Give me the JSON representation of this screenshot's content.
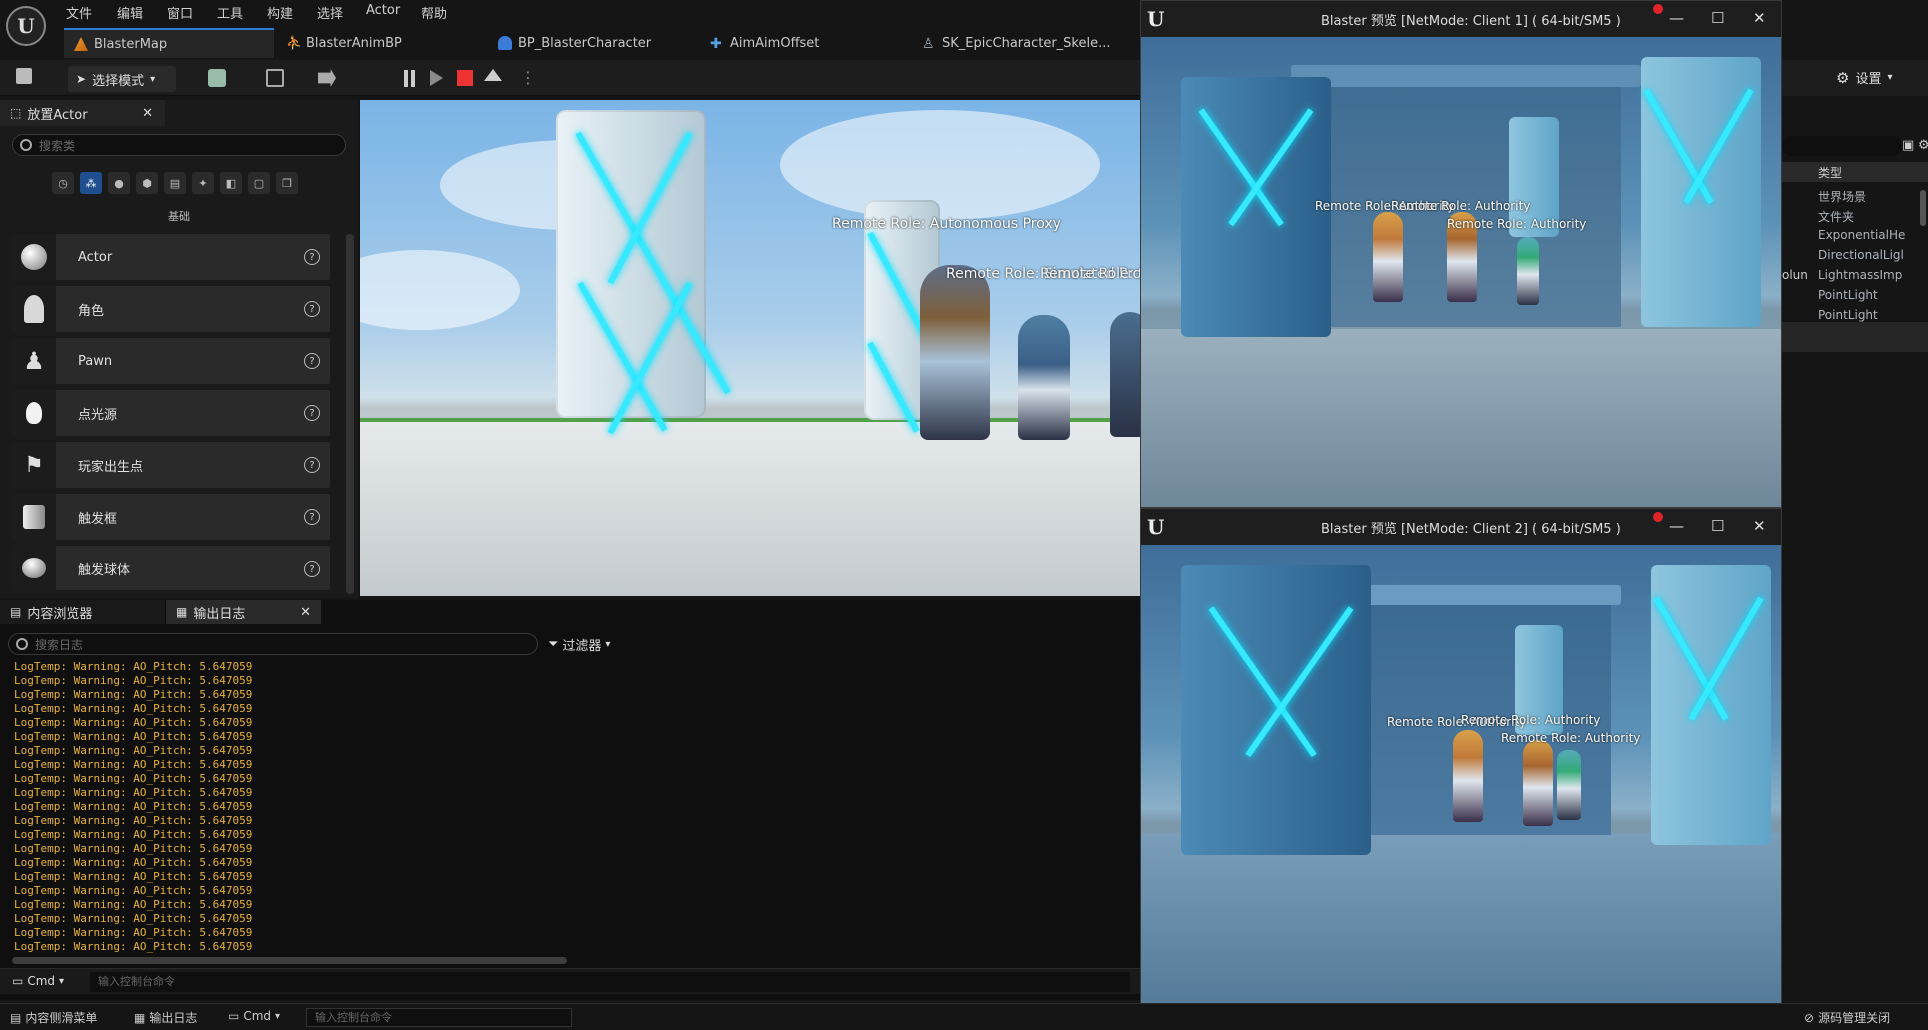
{
  "menu": {
    "items": [
      "文件",
      "编辑",
      "窗口",
      "工具",
      "构建",
      "选择",
      "Actor",
      "帮助"
    ]
  },
  "tabs": [
    {
      "label": "BlasterMap",
      "icon": "map-icon",
      "active": true
    },
    {
      "label": "BlasterAnimBP",
      "icon": "anim-blueprint-icon",
      "active": false
    },
    {
      "label": "BP_BlasterCharacter",
      "icon": "character-icon",
      "active": false
    },
    {
      "label": "AimAimOffset",
      "icon": "aim-offset-icon",
      "active": false
    },
    {
      "label": "SK_EpicCharacter_Skele...",
      "icon": "skeleton-icon",
      "active": false
    }
  ],
  "toolbar": {
    "mode_label": "选择模式",
    "settings_label": "设置"
  },
  "place_actor": {
    "title": "放置Actor",
    "search_placeholder": "搜索类",
    "category": "基础",
    "items": [
      {
        "label": "Actor",
        "icon": "sphere-icon"
      },
      {
        "label": "角色",
        "icon": "character-icon"
      },
      {
        "label": "Pawn",
        "icon": "pawn-icon"
      },
      {
        "label": "点光源",
        "icon": "point-light-icon"
      },
      {
        "label": "玩家出生点",
        "icon": "player-start-icon"
      },
      {
        "label": "触发框",
        "icon": "trigger-box-icon"
      },
      {
        "label": "触发球体",
        "icon": "trigger-sphere-icon"
      }
    ]
  },
  "viewport": {
    "labels": [
      "Remote Role: Autonomous Proxy",
      "Remote Role: Simulated Proxy",
      "Remote Role: Simulated Pro"
    ]
  },
  "log_panel": {
    "tabs": [
      {
        "label": "内容浏览器"
      },
      {
        "label": "输出日志"
      }
    ],
    "search_placeholder": "搜索日志",
    "filter_label": "过滤器",
    "lines": [
      "LogTemp: Warning: AO_Pitch: 5.647059",
      "LogTemp: Warning: AO_Pitch: 5.647059",
      "LogTemp: Warning: AO_Pitch: 5.647059",
      "LogTemp: Warning: AO_Pitch: 5.647059",
      "LogTemp: Warning: AO_Pitch: 5.647059",
      "LogTemp: Warning: AO_Pitch: 5.647059",
      "LogTemp: Warning: AO_Pitch: 5.647059",
      "LogTemp: Warning: AO_Pitch: 5.647059",
      "LogTemp: Warning: AO_Pitch: 5.647059",
      "LogTemp: Warning: AO_Pitch: 5.647059",
      "LogTemp: Warning: AO_Pitch: 5.647059",
      "LogTemp: Warning: AO_Pitch: 5.647059",
      "LogTemp: Warning: AO_Pitch: 5.647059",
      "LogTemp: Warning: AO_Pitch: 5.647059",
      "LogTemp: Warning: AO_Pitch: 5.647059",
      "LogTemp: Warning: AO_Pitch: 5.647059",
      "LogTemp: Warning: AO_Pitch: 5.647059",
      "LogTemp: Warning: AO_Pitch: 5.647059",
      "LogTemp: Warning: AO_Pitch: 5.647059",
      "LogTemp: Warning: AO_Pitch: 5.647059",
      "LogTemp: Warning: AO_Pitch: 5.647059"
    ],
    "cmd_label": "Cmd",
    "cmd_placeholder": "输入控制台命令"
  },
  "statusbar": {
    "drawer_label": "内容侧滑菜单",
    "log_label": "输出日志",
    "cmd_label": "Cmd",
    "cmd_placeholder": "输入控制台命令",
    "source_control": "源码管理关闭"
  },
  "outliner": {
    "header": "类型",
    "rows": [
      "世界场景",
      "文件夹",
      "ExponentialHe",
      "DirectionalLigl",
      "LightmassImp",
      "PointLight",
      "PointLight"
    ],
    "side_text": "olun"
  },
  "client1": {
    "title": "Blaster 预览 [NetMode: Client 1]  ( 64-bit/SM5 )",
    "labels": [
      "Remote Role: Authority",
      "Remote Role: Authority",
      "Remote Role: Authority"
    ]
  },
  "client2": {
    "title": "Blaster 预览 [NetMode: Client 2]  ( 64-bit/SM5 )",
    "labels": [
      "Remote Role: Authority",
      "Remote Role: Authority",
      "Remote Role: Authority"
    ]
  }
}
